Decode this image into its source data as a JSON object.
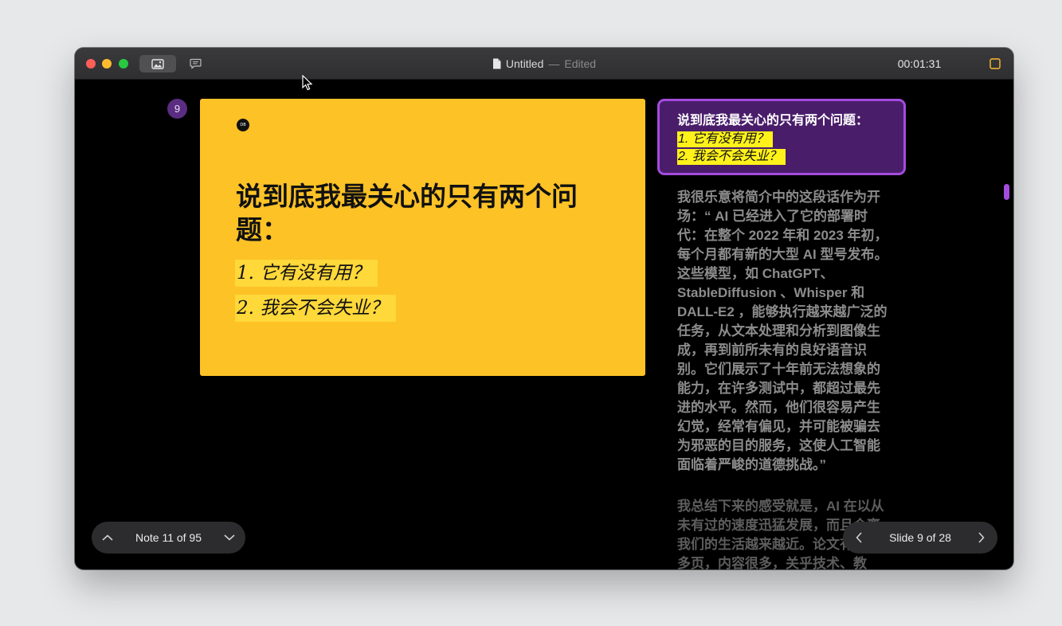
{
  "window": {
    "title": "Untitled",
    "title_separator": "—",
    "title_status": "Edited",
    "timer": "00:01:31"
  },
  "slide": {
    "number": "9",
    "logo_text": "DB",
    "heading": "说到底我最关心的只有两个问题：",
    "questions": [
      "1. 它有没有用？",
      "2. 我会不会失业？"
    ],
    "background_color": "#fcc226"
  },
  "note_card": {
    "heading": "说到底我最关心的只有两个问题：",
    "questions": [
      "1. 它有没有用？",
      "2. 我会不会失业？"
    ]
  },
  "notes": {
    "paragraph_1": "我很乐意将简介中的这段话作为开场：“ AI 已经进入了它的部署时代：在整个 2022 年和 2023 年初，每个月都有新的大型 AI 型号发布。这些模型，如 ChatGPT、StableDiffusion 、Whisper 和 DALL-E2 ，能够执行越来越广泛的任务，从文本处理和分析到图像生成，再到前所未有的良好语音识别。它们展示了十年前无法想象的能力，在许多测试中，都超过最先进的水平。然而，他们很容易产生幻觉，经常有偏见，并可能被骗去为邪恶的目的服务，这使人工智能面临着严峻的道德挑战。”",
    "paragraph_2": "我总结下来的感受就是，AI 在以从未有过的速度迅猛发展，而且会离我们的生活越来越近。论文有一百多页，内容很多，关乎技术、教"
  },
  "nav": {
    "note_counter": "Note 11 of 95",
    "slide_counter": "Slide 9 of 28"
  },
  "colors": {
    "accent": "#a44cdc",
    "note_card_bg": "#4a1d6b",
    "highlight": "#fff21a"
  }
}
